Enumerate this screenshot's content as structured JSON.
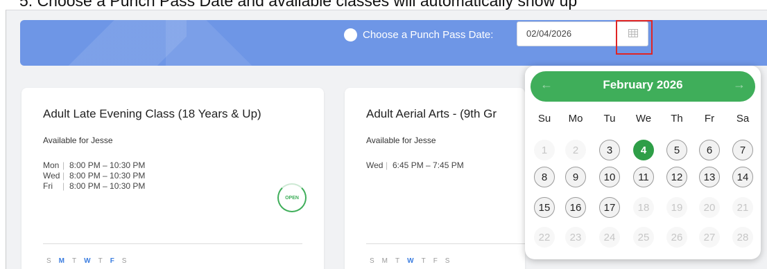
{
  "caption": "5.  Choose a Punch Pass Date and available classes will automatically show up",
  "banner": {
    "label": "Choose a Punch Pass Date:",
    "date_value": "02/04/2026"
  },
  "cards": [
    {
      "title": "Adult Late Evening Class (18 Years & Up)",
      "available": "Available for Jesse",
      "schedule": [
        {
          "day": "Mon",
          "time": "8:00 PM – 10:30 PM"
        },
        {
          "day": "Wed",
          "time": "8:00 PM – 10:30 PM"
        },
        {
          "day": "Fri",
          "time": "8:00 PM – 10:30 PM"
        }
      ],
      "status": "OPEN",
      "weekdays": [
        {
          "l": "S",
          "on": false
        },
        {
          "l": "M",
          "on": true
        },
        {
          "l": "T",
          "on": false
        },
        {
          "l": "W",
          "on": true
        },
        {
          "l": "T",
          "on": false
        },
        {
          "l": "F",
          "on": true
        },
        {
          "l": "S",
          "on": false
        }
      ]
    },
    {
      "title": "Adult Aerial Arts - (9th Gr",
      "available": "Available for Jesse",
      "schedule": [
        {
          "day": "Wed",
          "time": "6:45 PM – 7:45 PM"
        }
      ],
      "weekdays": [
        {
          "l": "S",
          "on": false
        },
        {
          "l": "M",
          "on": false
        },
        {
          "l": "T",
          "on": false
        },
        {
          "l": "W",
          "on": true
        },
        {
          "l": "T",
          "on": false
        },
        {
          "l": "F",
          "on": false
        },
        {
          "l": "S",
          "on": false
        }
      ]
    }
  ],
  "calendar": {
    "month_label": "February 2026",
    "prev_arrow": "←",
    "next_arrow": "→",
    "weekdays": [
      "Su",
      "Mo",
      "Tu",
      "We",
      "Th",
      "Fr",
      "Sa"
    ],
    "weeks": [
      [
        1,
        2,
        3,
        4,
        5,
        6,
        7
      ],
      [
        8,
        9,
        10,
        11,
        12,
        13,
        14
      ],
      [
        15,
        16,
        17,
        18,
        19,
        20,
        21
      ],
      [
        22,
        23,
        24,
        25,
        26,
        27,
        28
      ]
    ],
    "enabled_days": [
      3,
      5,
      6,
      7,
      8,
      9,
      10,
      11,
      12,
      13,
      14,
      15,
      16,
      17
    ],
    "selected_day": 4
  }
}
